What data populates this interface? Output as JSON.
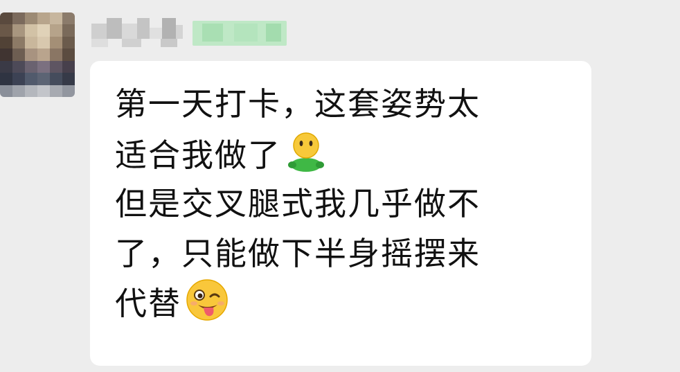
{
  "chat": {
    "message": {
      "lines": [
        "第一天打卡，这套姿势太",
        "适合我做了",
        "但是交叉腿式我几乎做不",
        "了，只能做下半身摇摆来",
        "代替"
      ],
      "inline_emojis": [
        "person-emoji",
        "wink-tongue-emoji"
      ]
    }
  },
  "colors": {
    "background": "#ededed",
    "bubble": "#ffffff",
    "text": "#111111"
  }
}
